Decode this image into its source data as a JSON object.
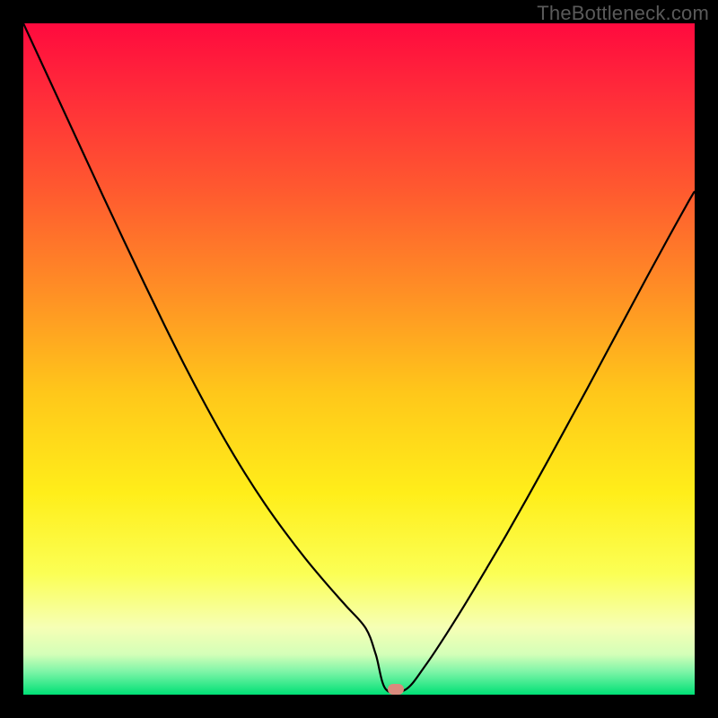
{
  "watermark": "TheBottleneck.com",
  "chart_data": {
    "type": "line",
    "title": "",
    "xlabel": "",
    "ylabel": "",
    "xlim": [
      0,
      100
    ],
    "ylim": [
      0,
      100
    ],
    "background_gradient": {
      "type": "vertical",
      "stops": [
        {
          "pos": 0.0,
          "color": "#ff0a3e"
        },
        {
          "pos": 0.1,
          "color": "#ff2a3a"
        },
        {
          "pos": 0.25,
          "color": "#ff5a2f"
        },
        {
          "pos": 0.4,
          "color": "#ff8f25"
        },
        {
          "pos": 0.55,
          "color": "#ffc71a"
        },
        {
          "pos": 0.7,
          "color": "#ffee1a"
        },
        {
          "pos": 0.82,
          "color": "#fbff55"
        },
        {
          "pos": 0.9,
          "color": "#f6ffb5"
        },
        {
          "pos": 0.94,
          "color": "#d4ffb8"
        },
        {
          "pos": 0.965,
          "color": "#80f5a8"
        },
        {
          "pos": 1.0,
          "color": "#00e076"
        }
      ]
    },
    "series": [
      {
        "name": "bottleneck-curve",
        "color": "#000000",
        "stroke_width": 2.2,
        "x": [
          0.0,
          3,
          6,
          9,
          12,
          15,
          18,
          21,
          24,
          27,
          30,
          33,
          36,
          39,
          42,
          45,
          48,
          51,
          52.5,
          54,
          57,
          60,
          63,
          66,
          69,
          72,
          75,
          78,
          81,
          84,
          87,
          90,
          93,
          96,
          99,
          100
        ],
        "y": [
          100,
          93.5,
          87,
          80.5,
          74,
          67.6,
          61.3,
          55.1,
          49.1,
          43.4,
          38,
          33,
          28.4,
          24.2,
          20.3,
          16.7,
          13.3,
          9.9,
          6.0,
          0.8,
          0.8,
          4.5,
          9.0,
          13.8,
          18.8,
          23.9,
          29.2,
          34.6,
          40.1,
          45.6,
          51.2,
          56.8,
          62.4,
          67.9,
          73.3,
          75.0
        ]
      }
    ],
    "marker": {
      "x": 55.5,
      "y": 0.8,
      "color": "#d98a7d"
    }
  }
}
